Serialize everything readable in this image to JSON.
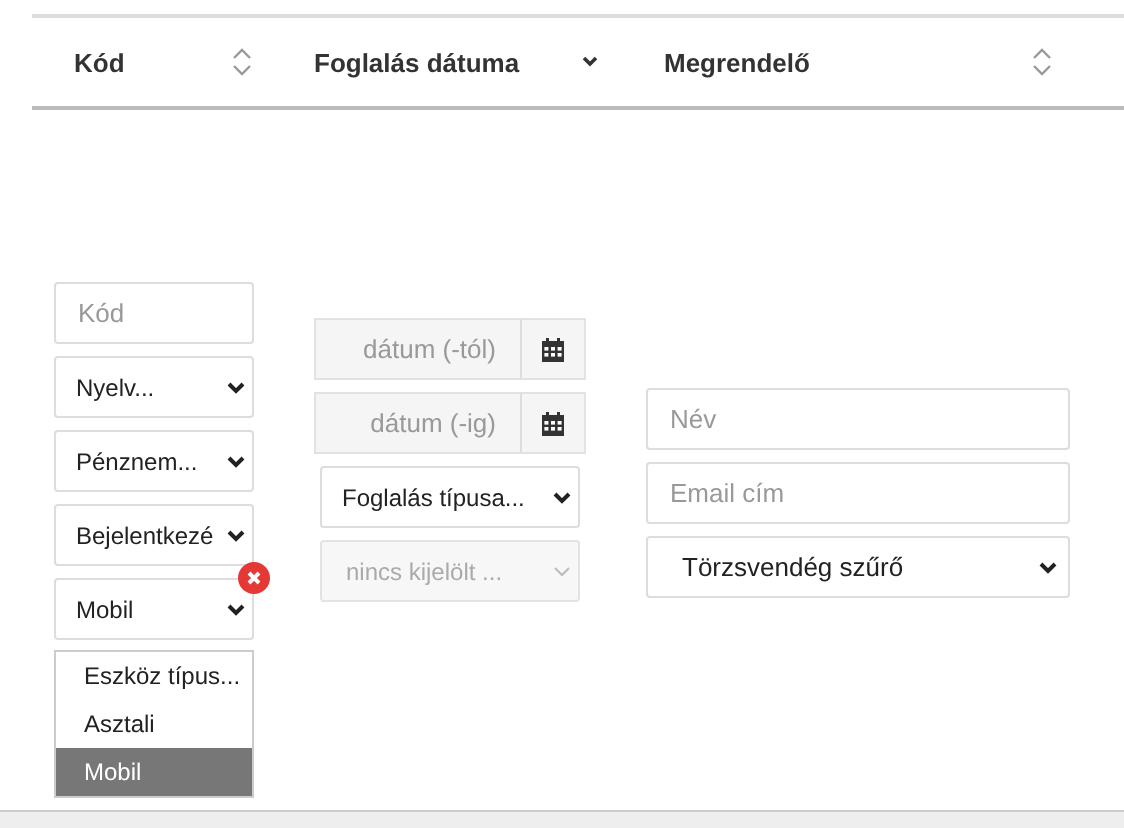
{
  "table": {
    "columns": [
      {
        "label": "Kód",
        "sorted": false
      },
      {
        "label": "Foglalás dátuma",
        "sorted": true
      },
      {
        "label": "Megrendelő",
        "sorted": false
      }
    ]
  },
  "filters": {
    "columns": [
      {
        "fields": [
          {
            "kind": "input",
            "placeholder": "Kód"
          },
          {
            "kind": "select",
            "value": "Nyelv..."
          },
          {
            "kind": "select",
            "value": "Pénznem..."
          },
          {
            "kind": "select",
            "value": "Bejelentkezé"
          },
          {
            "kind": "select",
            "value": "Mobil",
            "clearable": true,
            "expanded": true,
            "options": [
              {
                "label": "Eszköz típus...",
                "selected": false
              },
              {
                "label": "Asztali",
                "selected": false
              },
              {
                "label": "Mobil",
                "selected": true
              }
            ]
          }
        ]
      },
      {
        "fields": [
          {
            "kind": "date",
            "placeholder": "dátum (-tól)"
          },
          {
            "kind": "date",
            "placeholder": "dátum (-ig)"
          },
          {
            "kind": "select",
            "value": "Foglalás típusa..."
          },
          {
            "kind": "select",
            "placeholder": "nincs kijelölt ...",
            "disabled": true
          }
        ]
      },
      {
        "fields": [
          {
            "kind": "input",
            "placeholder": "Név"
          },
          {
            "kind": "input",
            "placeholder": "Email cím"
          },
          {
            "kind": "select",
            "value": "Törzsvendég szűrő"
          }
        ]
      }
    ]
  }
}
